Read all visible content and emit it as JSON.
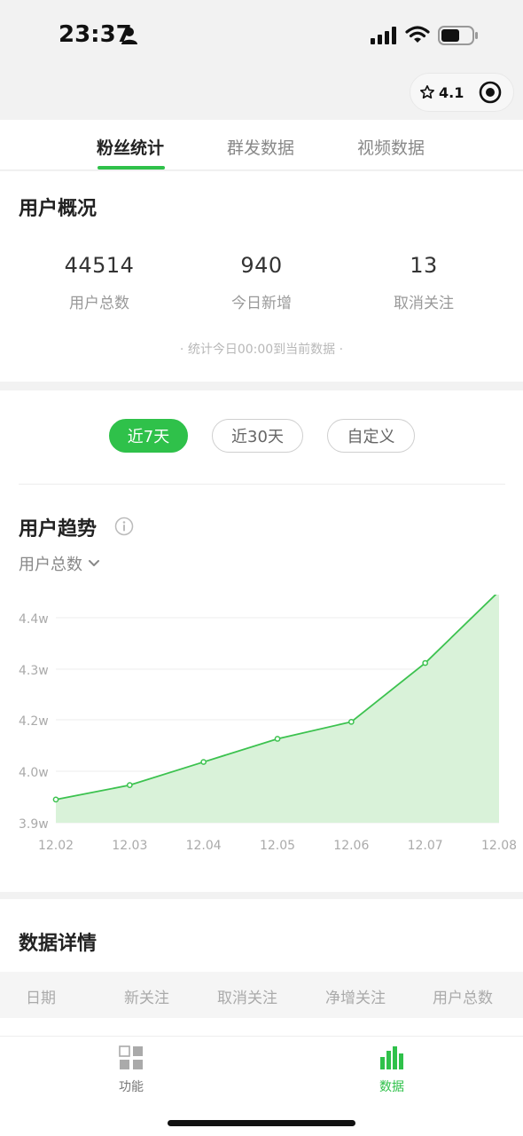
{
  "status_bar": {
    "time": "23:37"
  },
  "capsule": {
    "rating": "4.1"
  },
  "tabs": [
    {
      "label": "粉丝统计"
    },
    {
      "label": "群发数据"
    },
    {
      "label": "视频数据"
    }
  ],
  "overview": {
    "title": "用户概况",
    "stats": [
      {
        "value": "44514",
        "label": "用户总数"
      },
      {
        "value": "940",
        "label": "今日新增"
      },
      {
        "value": "13",
        "label": "取消关注"
      }
    ],
    "note": "· 统计今日00:00到当前数据 ·"
  },
  "ranges": [
    {
      "label": "近7天",
      "active": true
    },
    {
      "label": "近30天",
      "active": false
    },
    {
      "label": "自定义",
      "active": false
    }
  ],
  "trend": {
    "title": "用户趋势",
    "metric": "用户总数"
  },
  "chart_data": {
    "type": "area",
    "x": [
      "12.02",
      "12.03",
      "12.04",
      "12.05",
      "12.06",
      "12.07",
      "12.08"
    ],
    "values": [
      39450,
      39730,
      40360,
      41260,
      41920,
      43120,
      44514
    ],
    "y_ticks": [
      {
        "value": 39000,
        "label": "3.9w"
      },
      {
        "value": 40000,
        "label": "4.0w"
      },
      {
        "value": 42000,
        "label": "4.2w"
      },
      {
        "value": 43000,
        "label": "4.3w"
      },
      {
        "value": 44000,
        "label": "4.4w"
      }
    ],
    "grid": true,
    "color": "#3cc24f",
    "fill_color": "#d9f2d9"
  },
  "details": {
    "title": "数据详情",
    "columns": [
      "日期",
      "新关注",
      "取消关注",
      "净增关注",
      "用户总数"
    ]
  },
  "bottom_nav": [
    {
      "label": "功能",
      "active": false
    },
    {
      "label": "数据",
      "active": true
    }
  ],
  "colors": {
    "accent": "#2fc14a",
    "muted": "#999999"
  }
}
